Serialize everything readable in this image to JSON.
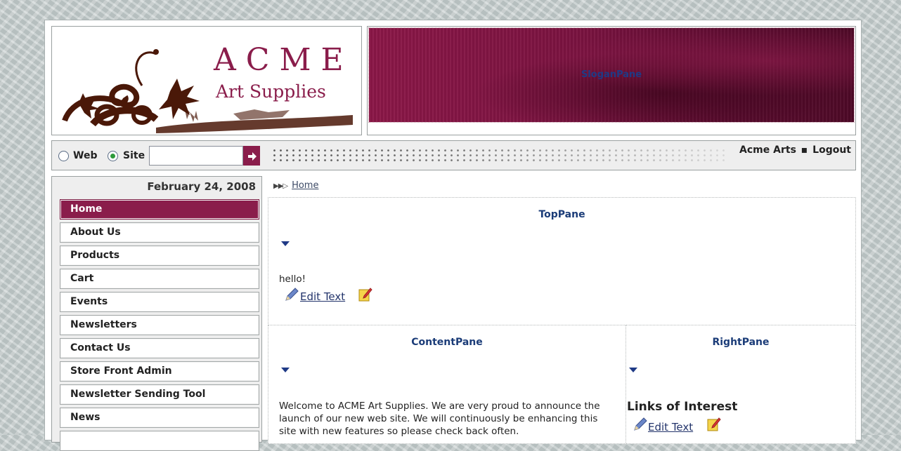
{
  "header": {
    "logo_title": "ACME",
    "logo_subtitle": "Art Supplies",
    "slogan_pane_label": "SloganPane"
  },
  "search": {
    "option_web": "Web",
    "option_site": "Site",
    "selected": "Site",
    "input_value": "",
    "go_icon": "arrow-right-icon"
  },
  "user": {
    "name": "Acme Arts",
    "separator": "▪",
    "logout": "Logout"
  },
  "date": "February 24, 2008",
  "nav": {
    "items": [
      {
        "label": "Home"
      },
      {
        "label": "About Us"
      },
      {
        "label": "Products"
      },
      {
        "label": "Cart"
      },
      {
        "label": "Events"
      },
      {
        "label": "Newsletters"
      },
      {
        "label": "Contact Us"
      },
      {
        "label": "Store Front Admin"
      },
      {
        "label": "Newsletter Sending Tool"
      },
      {
        "label": "News"
      },
      {
        "label": ""
      }
    ],
    "active_index": 0
  },
  "breadcrumb": {
    "items": [
      "Home"
    ]
  },
  "panes": {
    "top": {
      "title": "TopPane",
      "text": "hello!",
      "edit_label": "Edit Text"
    },
    "content": {
      "title": "ContentPane",
      "text": "Welcome to ACME Art Supplies.  We are very proud to announce the launch of our new web site.  We will continuously be enhancing this site with new features so please check back often."
    },
    "right": {
      "title": "RightPane",
      "heading": "Links of Interest",
      "edit_label": "Edit Text"
    }
  },
  "colors": {
    "accent": "#8a1d4b",
    "pane_title": "#1b3c78"
  }
}
